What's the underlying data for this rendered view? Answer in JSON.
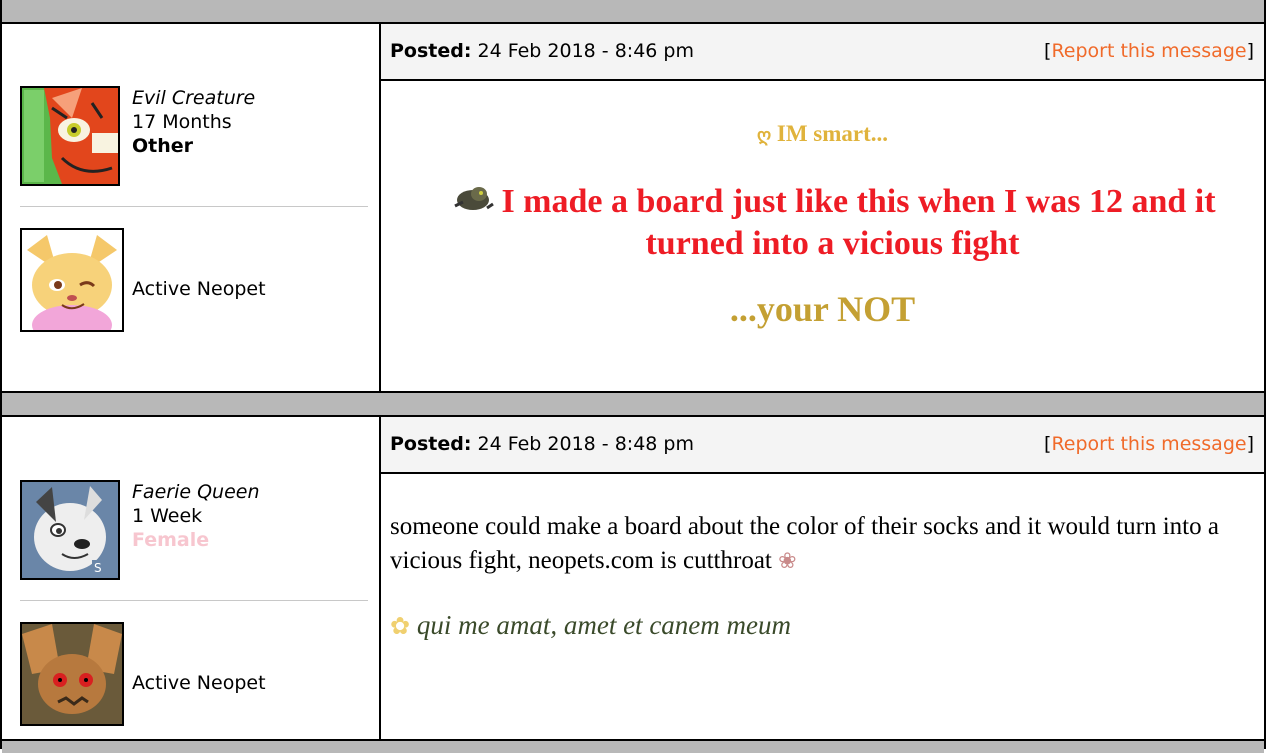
{
  "posts": [
    {
      "user": {
        "username": "Evil Creature",
        "age": "17 Months",
        "gender": "Other",
        "gender_color": "#000000",
        "active_pet_label": "Active Neopet"
      },
      "header": {
        "posted_label": "Posted:",
        "timestamp": "24 Feb 2018 - 8:46 pm",
        "report_label": "Report this message"
      },
      "body": {
        "line1": "IM smart...",
        "line2": "I made a board just like this when I was 12 and it turned into a vicious fight",
        "line3": "...your NOT",
        "colors": {
          "line1": "#e0b33c",
          "line2": "#ee1c25",
          "line3": "#c4a033"
        }
      }
    },
    {
      "user": {
        "username": "Faerie Queen",
        "age": "1 Week",
        "gender": "Female",
        "gender_color": "#f7c6cf",
        "active_pet_label": "Active Neopet"
      },
      "header": {
        "posted_label": "Posted:",
        "timestamp": "24 Feb 2018 - 8:48 pm",
        "report_label": "Report this message"
      },
      "body": {
        "text": "someone could make a board about the color of their socks and it would turn into a vicious fight, neopets.com is cutthroat",
        "signature": "qui me amat, amet et canem meum",
        "signature_color": "#3a4a2a"
      }
    }
  ],
  "colors": {
    "separator": "#b8b8b8",
    "header_bg": "#f4f4f4",
    "report_link": "#f06a2a"
  }
}
